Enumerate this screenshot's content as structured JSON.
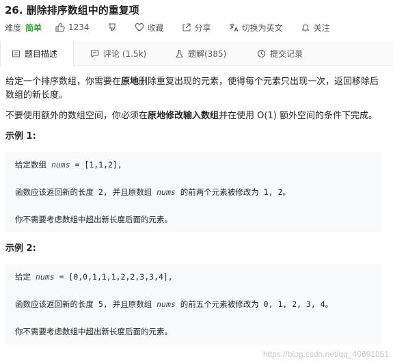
{
  "problem": {
    "title": "26. 删除排序数组中的重复项"
  },
  "meta": {
    "difficulty_label": "难度",
    "difficulty": "简单",
    "likes": "1234",
    "favorite": "收藏",
    "share": "分享",
    "switch_lang": "切换为英文",
    "follow": "关注",
    "colors": {
      "easy": "#43a047"
    }
  },
  "tabs": [
    {
      "label": "题目描述",
      "icon": "document-icon"
    },
    {
      "label": "评论 (1.5k)",
      "icon": "comment-icon"
    },
    {
      "label": "题解(385)",
      "icon": "flask-icon"
    },
    {
      "label": "提交记录",
      "icon": "clock-icon"
    }
  ],
  "description": {
    "p1_a": "给定一个排序数组，你需要在",
    "p1_b": "原地",
    "p1_c": "删除重复出现的元素，使得每个元素只出现一次，返回移除后数组的新长度。",
    "p2_a": "不要使用额外的数组空间，你必须在",
    "p2_b": "原地修改输入数组",
    "p2_c": "并在使用 O(1) 额外空间的条件下完成。"
  },
  "examples": [
    {
      "title": "示例 1:",
      "l1_a": "给定数组 ",
      "l1_var": "nums",
      "l1_b": " = [1,1,2],",
      "l2_a": "函数应该返回新的长度 2, 并且原数组 ",
      "l2_var": "nums",
      "l2_b": " 的前两个元素被修改为 1, 2。",
      "l3": "你不需要考虑数组中超出新长度后面的元素。"
    },
    {
      "title": "示例 2:",
      "l1_a": "给定 ",
      "l1_var": "nums",
      "l1_b": " = [0,0,1,1,1,2,2,3,3,4],",
      "l2_a": "函数应该返回新的长度 5, 并且原数组 ",
      "l2_var": "nums",
      "l2_b": " 的前五个元素被修改为 0, 1, 2, 3, 4。",
      "l3": "你不需要考虑数组中超出新长度后面的元素。"
    }
  ],
  "watermark": "https://blog.csdn.net/qq_40691051"
}
